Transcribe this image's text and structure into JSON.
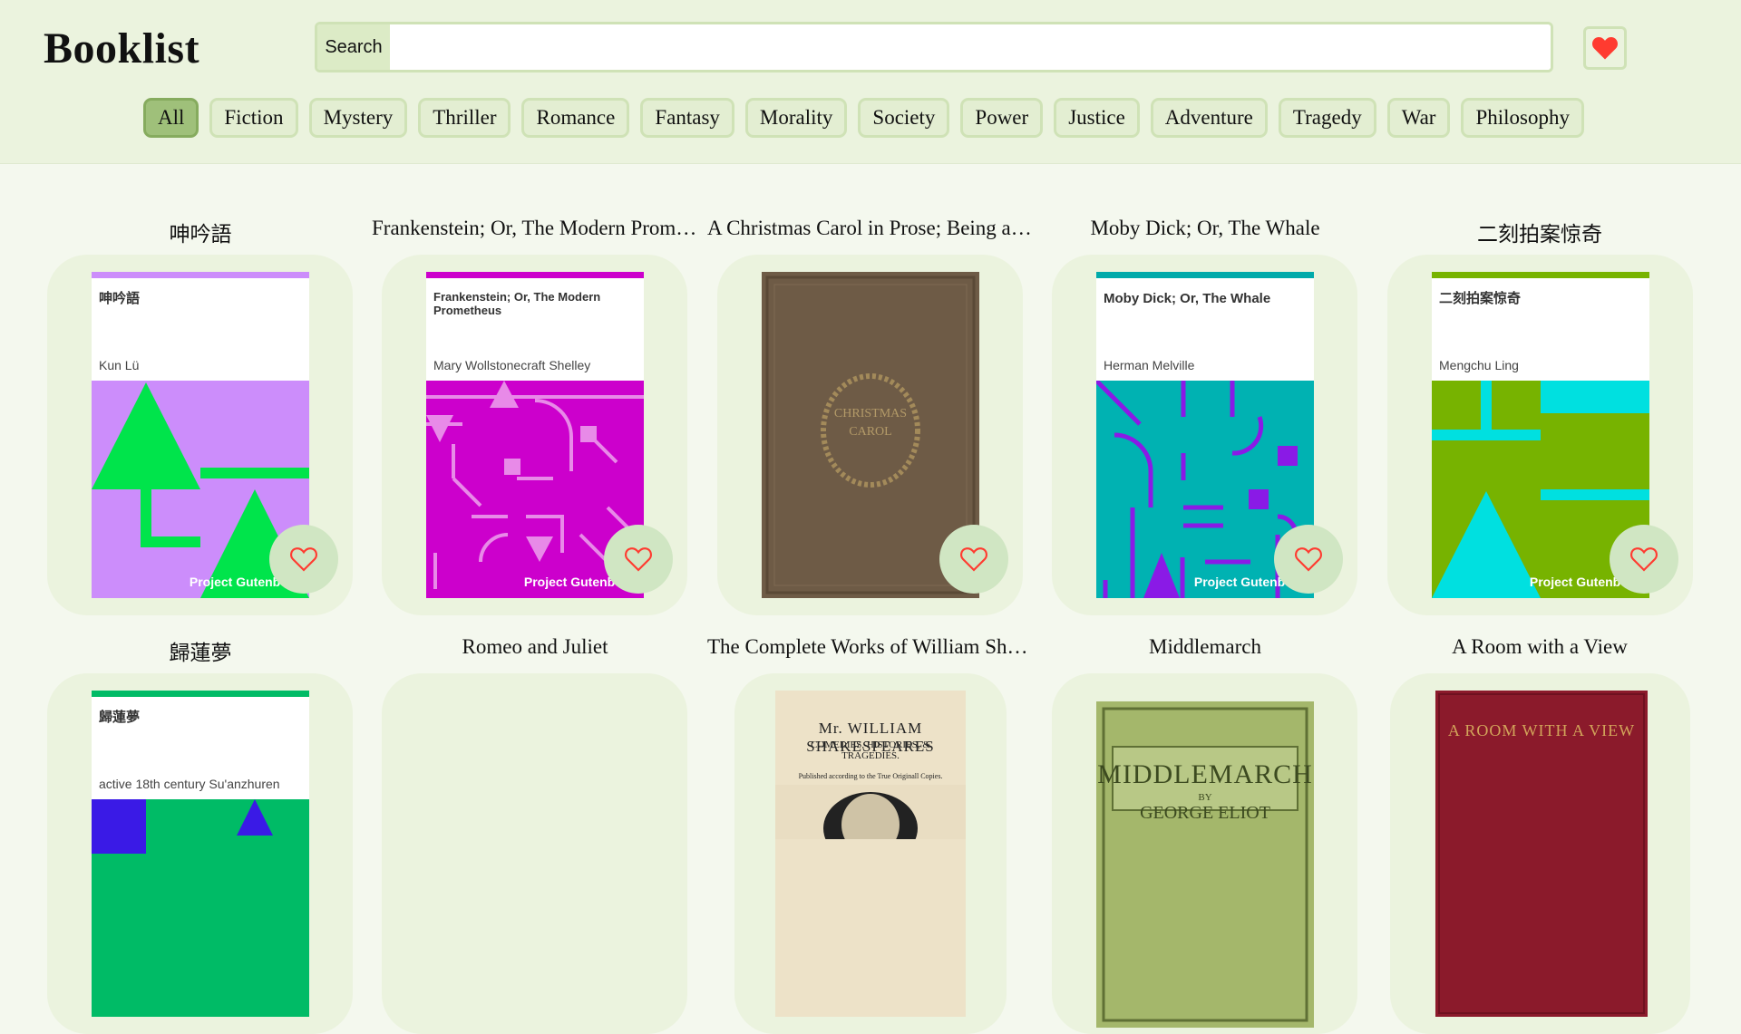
{
  "header": {
    "logo": "Booklist",
    "search_label": "Search",
    "search_value": "",
    "favorites_icon": "heart-icon",
    "favorites_color": "#ff3b30"
  },
  "tags": [
    "All",
    "Fiction",
    "Mystery",
    "Thriller",
    "Romance",
    "Fantasy",
    "Morality",
    "Society",
    "Power",
    "Justice",
    "Adventure",
    "Tragedy",
    "War",
    "Philosophy"
  ],
  "active_tag": "All",
  "books": [
    {
      "title": "呻吟語",
      "cover_title": "呻吟語",
      "author": "Kun Lü",
      "publisher": "Project Gutenberg",
      "accent": "#cc8dfb"
    },
    {
      "title": "Frankenstein; Or, The Modern Prometheus",
      "cover_title": "Frankenstein; Or, The Modern Prometheus",
      "author": "Mary Wollstonecraft Shelley",
      "publisher": "Project Gutenberg",
      "accent": "#cc00cc"
    },
    {
      "title": "A Christmas Carol in Prose; Being a Ghost Story of Christmas",
      "cover_title": "A CHRISTMAS CAROL",
      "author": "",
      "publisher": "",
      "accent": "#6b5a45"
    },
    {
      "title": "Moby Dick; Or, The Whale",
      "cover_title": "Moby Dick; Or, The Whale",
      "author": "Herman Melville",
      "publisher": "Project Gutenberg",
      "accent": "#00aaaa"
    },
    {
      "title": "二刻拍案惊奇",
      "cover_title": "二刻拍案惊奇",
      "author": "Mengchu Ling",
      "publisher": "Project Gutenberg",
      "accent": "#77b300"
    },
    {
      "title": "歸蓮夢",
      "cover_title": "歸蓮夢",
      "author": "active 18th century Su'anzhuren",
      "publisher": "",
      "accent": "#00bb66"
    },
    {
      "title": "Romeo and Juliet",
      "cover_title": "",
      "author": "",
      "publisher": "",
      "accent": "#ebf3de"
    },
    {
      "title": "The Complete Works of William Shakespeare",
      "cover_title": "Mr. WILLIAM SHAKESPEARES",
      "cover_subtitle": "COMEDIES, HISTORIES, & TRAGEDIES.",
      "cover_note": "Published according to the True Originall Copies.",
      "author": "",
      "publisher": "",
      "accent": "#e8dcc0"
    },
    {
      "title": "Middlemarch",
      "cover_title": "MIDDLEMARCH",
      "cover_by": "BY",
      "cover_author": "GEORGE ELIOT",
      "author": "",
      "publisher": "",
      "accent": "#a6b86e"
    },
    {
      "title": "A Room with a View",
      "cover_title": "A ROOM WITH A VIEW",
      "author": "",
      "publisher": "",
      "accent": "#8b1a2b"
    }
  ]
}
